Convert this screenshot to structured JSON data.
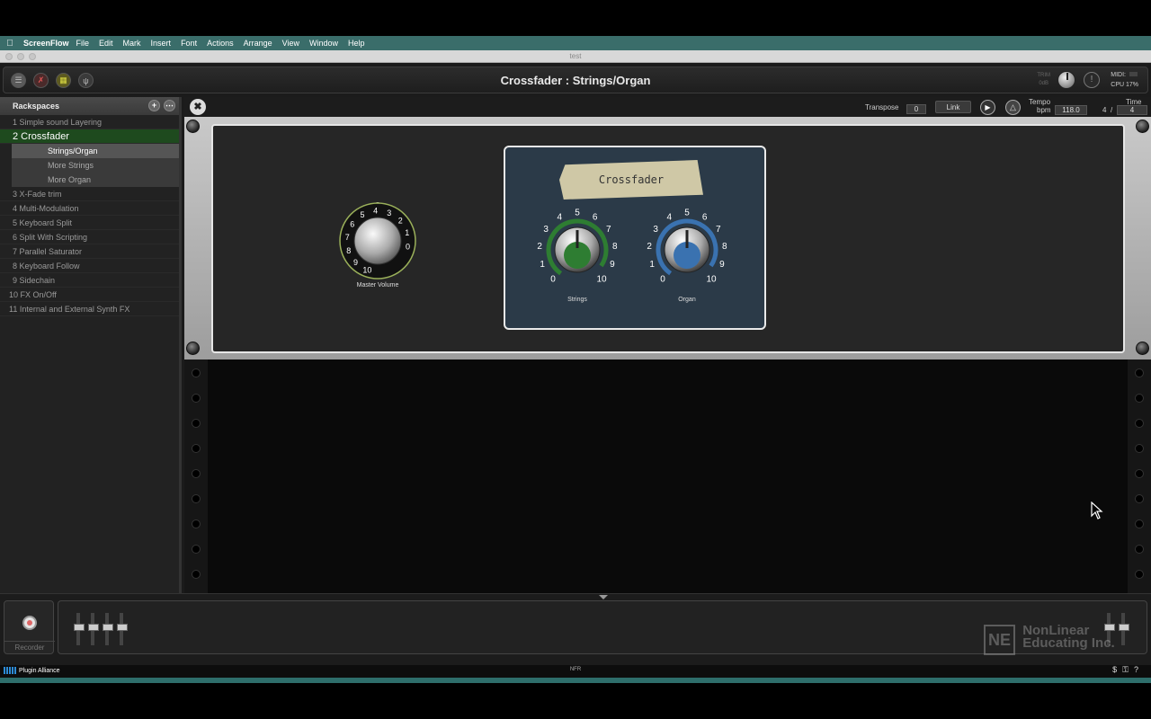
{
  "menubar": {
    "app_name": "ScreenFlow",
    "items": [
      "File",
      "Edit",
      "Mark",
      "Insert",
      "Font",
      "Actions",
      "Arrange",
      "View",
      "Window",
      "Help"
    ]
  },
  "window": {
    "title": "test"
  },
  "topbar": {
    "title": "Crossfader : Strings/Organ",
    "trim_label": "TRIM",
    "trim_unit": "0dB",
    "midi_label": "MIDI:",
    "cpu_label": "CPU 17%"
  },
  "sidebar": {
    "header": "Rackspaces",
    "rackspaces": [
      {
        "label": "1 Simple sound Layering",
        "active": false
      },
      {
        "label": "2 Crossfader",
        "active": true,
        "variations": [
          {
            "label": "Strings/Organ",
            "active": true
          },
          {
            "label": "More Strings",
            "active": false
          },
          {
            "label": "More Organ",
            "active": false
          }
        ]
      },
      {
        "label": "3 X-Fade trim"
      },
      {
        "label": "4 Multi-Modulation"
      },
      {
        "label": "5 Keyboard Split"
      },
      {
        "label": "6 Split With Scripting"
      },
      {
        "label": "7 Parallel Saturator"
      },
      {
        "label": "8 Keyboard Follow"
      },
      {
        "label": "9 Sidechain"
      },
      {
        "label": "10 FX On/Off"
      },
      {
        "label": "11 Internal and External Synth FX"
      }
    ]
  },
  "transport": {
    "transpose_label": "Transpose",
    "transpose_value": "0",
    "link_label": "Link",
    "tempo_label": "Tempo",
    "bpm_label": "bpm",
    "tempo_value": "118.0",
    "time_label": "Time",
    "time_sig_num": "4",
    "time_sig_sep": "/",
    "time_sig_den": "4"
  },
  "panel": {
    "master_volume_label": "Master Volume",
    "master_scale": [
      "0",
      "1",
      "2",
      "3",
      "4",
      "5",
      "6",
      "7",
      "8",
      "9",
      "10"
    ],
    "crossfader_title": "Crossfader",
    "strings_label": "Strings",
    "organ_label": "Organ",
    "knob_scale": [
      "0",
      "1",
      "2",
      "3",
      "4",
      "5",
      "6",
      "7",
      "8",
      "9",
      "10"
    ],
    "strings_color": "#2e7d32",
    "organ_color": "#3a72b0"
  },
  "bottom": {
    "recorder_label": "Recorder",
    "watermark_line1": "NonLinear",
    "watermark_line2": "Educating Inc.",
    "watermark_logo": "NE"
  },
  "statusbar": {
    "plugin_alliance": "Plugin Alliance",
    "nfr": "NFR"
  }
}
